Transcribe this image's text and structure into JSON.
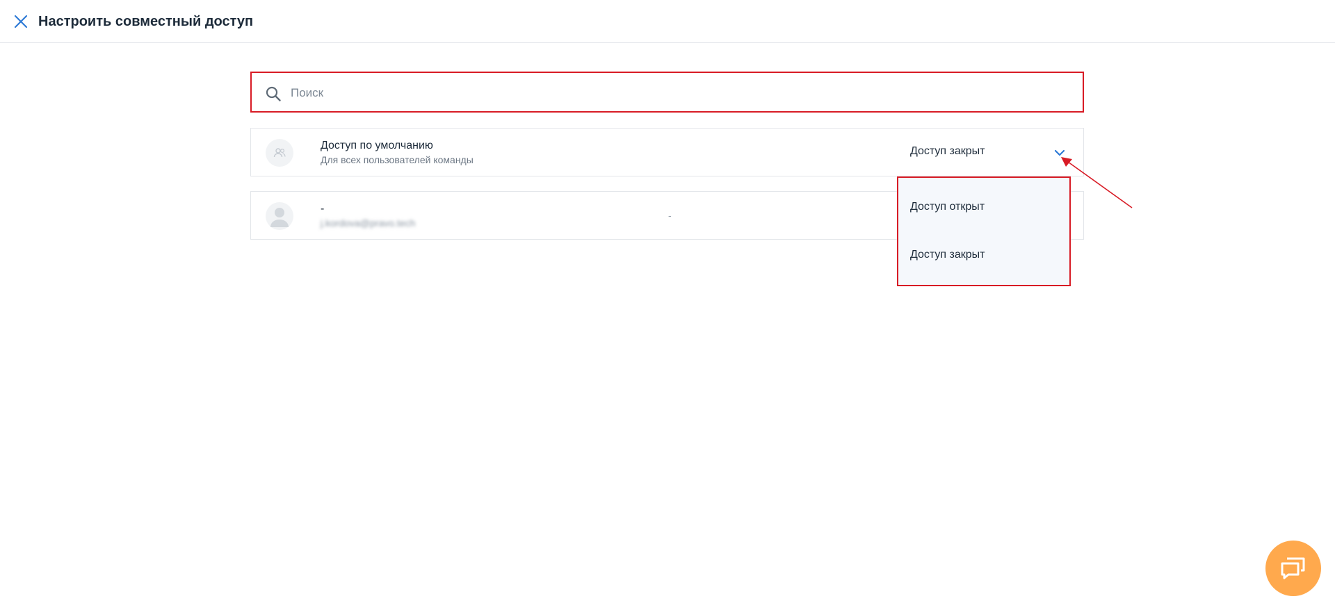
{
  "header": {
    "title": "Настроить совместный доступ"
  },
  "search": {
    "placeholder": "Поиск",
    "value": ""
  },
  "rows": [
    {
      "title": "Доступ по умолчанию",
      "subtitle": "Для всех пользователей команды",
      "access": "Доступ закрыт"
    },
    {
      "title": "-",
      "subtitle": "j.kordova@pravo.tech",
      "center": "-"
    }
  ],
  "dropdown": {
    "options": [
      "Доступ открыт",
      "Доступ закрыт"
    ]
  },
  "colors": {
    "accent": "#2f7bd6",
    "highlight": "#d81b25",
    "chat": "#ffa94d"
  }
}
